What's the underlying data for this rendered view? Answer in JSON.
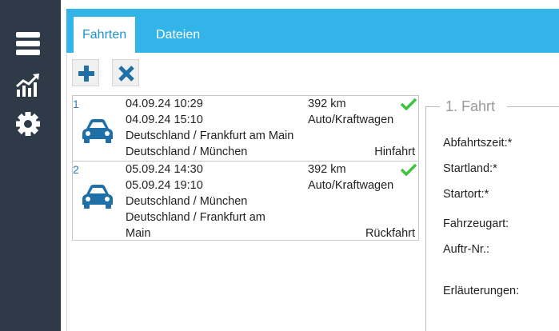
{
  "sidebar": {
    "items": [
      {
        "icon": "menu-icon"
      },
      {
        "icon": "chart-icon"
      },
      {
        "icon": "gear-icon"
      }
    ]
  },
  "tabs": [
    {
      "label": "Fahrten",
      "active": true
    },
    {
      "label": "Dateien",
      "active": false
    }
  ],
  "toolbar": {
    "add_icon": "plus-icon",
    "delete_icon": "x-icon"
  },
  "trips": [
    {
      "number": "1",
      "depart": "04.09.24 10:29",
      "arrive": "04.09.24 15:10",
      "from": "Deutschland / Frankfurt am Main",
      "to_line1": "Deutschland / München",
      "to_line2": "",
      "distance": "392 km",
      "vehicle": "Auto/Kraftwagen",
      "direction": "Hinfahrt"
    },
    {
      "number": "2",
      "depart": "05.09.24 14:30",
      "arrive": "05.09.24 19:10",
      "from": "Deutschland / München",
      "to_line1": "Deutschland / Frankfurt am",
      "to_line2": "Main",
      "distance": "392 km",
      "vehicle": "Auto/Kraftwagen",
      "direction": "Rückfahrt"
    }
  ],
  "form": {
    "legend": "1. Fahrt",
    "labels": {
      "departure": "Abfahrtszeit:*",
      "country": "Startland:*",
      "city": "Startort:*",
      "vehicle": "Fahrzeugart:",
      "order": "Auftr-Nr.:",
      "notes": "Erläuterungen:"
    }
  },
  "colors": {
    "sidebar": "#2e3a47",
    "tabbar": "#33b4e9",
    "accent": "#1f6fa8",
    "check": "#3cc43c"
  }
}
